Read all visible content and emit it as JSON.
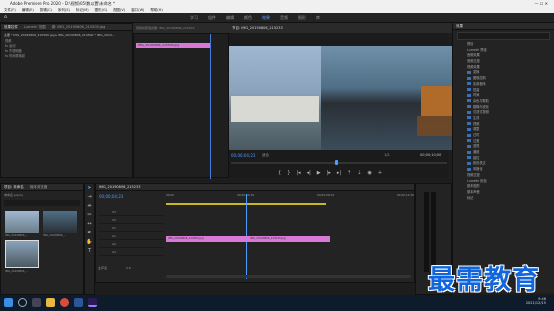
{
  "app": {
    "title": "Adobe Premiere Pro 2020 - D:\\视频\\05\\数以置\\未命名 *",
    "menu": [
      "文件(F)",
      "编辑(E)",
      "剪辑(C)",
      "序列(S)",
      "标记(M)",
      "图形(G)",
      "视图(V)",
      "窗口(W)",
      "帮助(H)"
    ]
  },
  "workspaces": [
    "学习",
    "组件",
    "编辑",
    "颜色",
    "效果",
    "音频",
    "图形",
    "库"
  ],
  "source_panel": {
    "tabs": [
      "效果控件",
      "Lumetri 范围",
      "源: IMG_20190806_210500.jpg",
      "音频剪辑混合器: IMG_20190806_215233"
    ],
    "header": "主要 * IMG_20190806_210500.jpg ▸ IMG_20190806_210500 * IMG_2019...",
    "items": [
      "视频",
      "fx 运动",
      "fx 不透明度",
      "fx 时间重映射"
    ],
    "clip_label": "IMG_20190806_210500.jpg"
  },
  "program": {
    "tab": "节目: IMG_20190806_215233",
    "timecode_left": "00;00;04;23",
    "fit": "适合",
    "quality": "1/2",
    "timecode_right": "00;00;10;00"
  },
  "project": {
    "tabs": [
      "项目: 未命名",
      "媒体浏览器"
    ],
    "name": "未命名.prproj",
    "clips": [
      {
        "name": "IMG_20190806_...",
        "duration": "5:00"
      },
      {
        "name": "IMG_20190806_...",
        "duration": "5:00"
      },
      {
        "name": "IMG_20190806_...",
        "duration": "10:00"
      }
    ]
  },
  "timeline": {
    "tab": "IMG_20190806_215233",
    "timecode": "00;00;04;23",
    "ruler": [
      "00;00",
      "00;00;04;29",
      "00;00;09;29",
      "00;00;14;29"
    ],
    "tracks": [
      "V3",
      "V2",
      "V1",
      "A1",
      "A2",
      "A3"
    ],
    "clips": [
      {
        "label": "IMG_20190806_210500.jpg",
        "track": "V1"
      },
      {
        "label": "IMG_20190806_215233.jpg",
        "track": "V1"
      }
    ],
    "master": "主声道",
    "master_value": "0.0"
  },
  "effects": {
    "tab": "效果",
    "sections": [
      "预设",
      "Lumetri 预设",
      "音频效果",
      "音频过渡",
      "视频效果"
    ],
    "categories": [
      "变换",
      "图像控制",
      "实用程序",
      "扭曲",
      "时间",
      "杂色与颗粒",
      "模糊与锐化",
      "沉浸式视频",
      "生成",
      "视频",
      "调整",
      "过时",
      "过渡",
      "透视",
      "通道",
      "键控",
      "颜色校正",
      "风格化"
    ],
    "more": [
      "视频过渡",
      "Lumetri 颜色",
      "基本图形",
      "基本声音",
      "标记"
    ],
    "footer": [
      "基本图形",
      "基本声音",
      "Lumetri 颜色",
      "库",
      "标记"
    ]
  },
  "taskbar": {
    "time": "9:46",
    "date": "2021/12/15"
  },
  "watermark": "最需教育",
  "colors": {
    "accent": "#5aa0ff",
    "clip": "#d77ad7",
    "watermark": "#1166dd"
  }
}
